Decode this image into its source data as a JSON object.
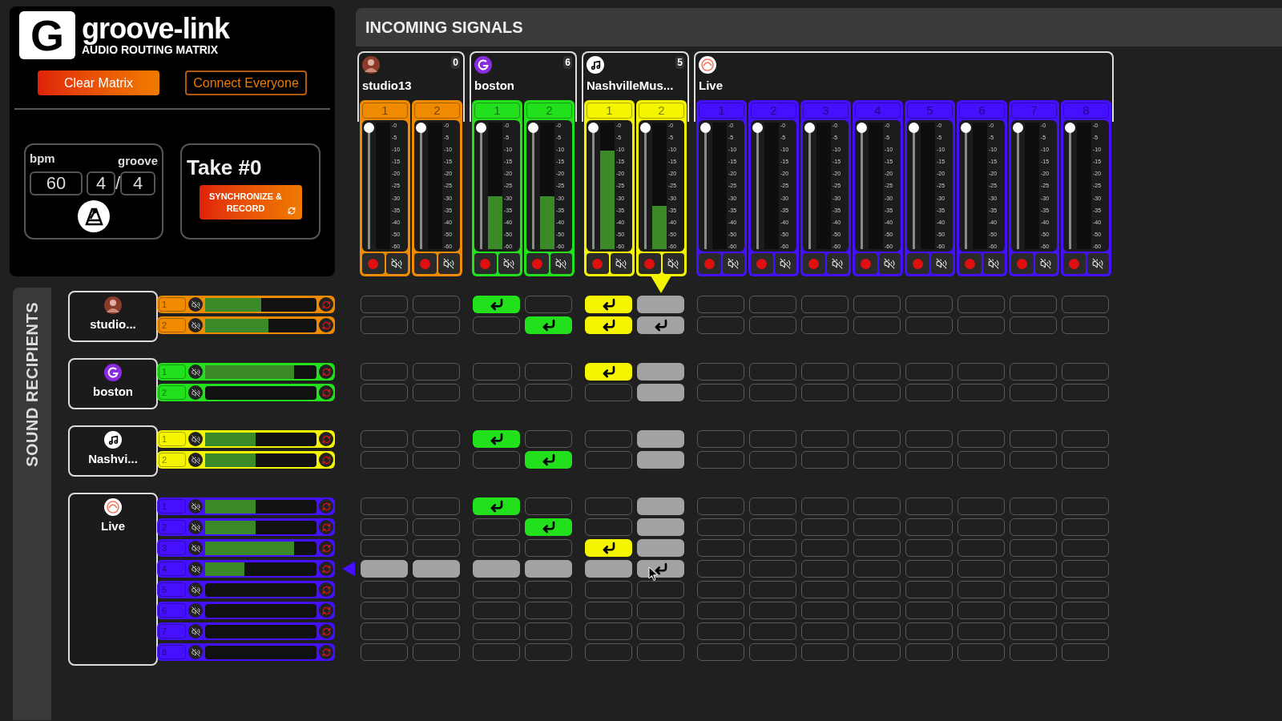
{
  "logo": {
    "mark": "G",
    "title": "groove-link",
    "subtitle": "AUDIO ROUTING MATRIX"
  },
  "actions": [
    {
      "label": "Clear Matrix",
      "kind": "filled"
    },
    {
      "label": "Connect Everyone",
      "kind": "outline"
    }
  ],
  "tempo": {
    "bpm_label": "bpm",
    "groove_label": "groove",
    "bpm": "60",
    "beats": "4",
    "separator": "/",
    "unit": "4"
  },
  "take": {
    "title": "Take #0",
    "button": "SYNCHRONIZE & RECORD"
  },
  "incoming": {
    "title": "INCOMING SIGNALS",
    "senders": [
      {
        "name": "studio13",
        "count": "0",
        "avatar": {
          "kind": "photo"
        },
        "color": "#f08a00",
        "channels": [
          {
            "label": "1",
            "hovered": false,
            "fader": {
              "level": 1
            },
            "meter": {
              "level": 0
            },
            "scale": [
              "-0",
              "-5",
              "-10",
              "-15",
              "-20",
              "-25",
              "-30",
              "-35",
              "-40",
              "-50",
              "-60"
            ]
          },
          {
            "label": "2",
            "hovered": false,
            "fader": {
              "level": 1
            },
            "meter": {
              "level": 0
            },
            "scale": [
              "-0",
              "-5",
              "-10",
              "-15",
              "-20",
              "-25",
              "-30",
              "-35",
              "-40",
              "-50",
              "-60"
            ]
          }
        ]
      },
      {
        "name": "boston",
        "count": "6",
        "avatar": {
          "kind": "logo"
        },
        "color": "#22e01c",
        "channels": [
          {
            "label": "1",
            "hovered": false,
            "fader": {
              "level": 1
            },
            "meter": {
              "level": 0.42
            },
            "scale": [
              "-0",
              "-5",
              "-10",
              "-15",
              "-20",
              "-25",
              "-30",
              "-35",
              "-40",
              "-50",
              "-60"
            ]
          },
          {
            "label": "2",
            "hovered": false,
            "fader": {
              "level": 1
            },
            "meter": {
              "level": 0.42
            },
            "scale": [
              "-0",
              "-5",
              "-10",
              "-15",
              "-20",
              "-25",
              "-30",
              "-35",
              "-40",
              "-50",
              "-60"
            ]
          }
        ]
      },
      {
        "name": "NashvilleMus...",
        "count": "5",
        "avatar": {
          "kind": "music"
        },
        "color": "#f5f500",
        "channels": [
          {
            "label": "1",
            "hovered": false,
            "fader": {
              "level": 1
            },
            "meter": {
              "level": 0.78
            },
            "scale": [
              "-0",
              "-5",
              "-10",
              "-15",
              "-20",
              "-25",
              "-30",
              "-35",
              "-40",
              "-50",
              "-60"
            ]
          },
          {
            "label": "2",
            "hovered": true,
            "fader": {
              "level": 1
            },
            "meter": {
              "level": 0.34
            },
            "scale": [
              "-0",
              "-5",
              "-10",
              "-15",
              "-20",
              "-25",
              "-30",
              "-35",
              "-40",
              "-50",
              "-60"
            ]
          }
        ]
      },
      {
        "name": "Live",
        "avatar": {
          "kind": "character"
        },
        "color": "#4510ff",
        "channels": [
          {
            "label": "1",
            "hovered": false,
            "fader": {
              "level": 1
            },
            "meter": {
              "level": 0
            },
            "scale": [
              "-0",
              "-5",
              "-10",
              "-15",
              "-20",
              "-25",
              "-30",
              "-35",
              "-40",
              "-50",
              "-60"
            ]
          },
          {
            "label": "2",
            "hovered": false,
            "fader": {
              "level": 1
            },
            "meter": {
              "level": 0
            },
            "scale": [
              "-0",
              "-5",
              "-10",
              "-15",
              "-20",
              "-25",
              "-30",
              "-35",
              "-40",
              "-50",
              "-60"
            ]
          },
          {
            "label": "3",
            "hovered": false,
            "fader": {
              "level": 1
            },
            "meter": {
              "level": 0
            },
            "scale": [
              "-0",
              "-5",
              "-10",
              "-15",
              "-20",
              "-25",
              "-30",
              "-35",
              "-40",
              "-50",
              "-60"
            ]
          },
          {
            "label": "4",
            "hovered": false,
            "fader": {
              "level": 1
            },
            "meter": {
              "level": 0
            },
            "scale": [
              "-0",
              "-5",
              "-10",
              "-15",
              "-20",
              "-25",
              "-30",
              "-35",
              "-40",
              "-50",
              "-60"
            ]
          },
          {
            "label": "5",
            "hovered": false,
            "fader": {
              "level": 1
            },
            "meter": {
              "level": 0
            },
            "scale": [
              "-0",
              "-5",
              "-10",
              "-15",
              "-20",
              "-25",
              "-30",
              "-35",
              "-40",
              "-50",
              "-60"
            ]
          },
          {
            "label": "6",
            "hovered": false,
            "fader": {
              "level": 1
            },
            "meter": {
              "level": 0
            },
            "scale": [
              "-0",
              "-5",
              "-10",
              "-15",
              "-20",
              "-25",
              "-30",
              "-35",
              "-40",
              "-50",
              "-60"
            ]
          },
          {
            "label": "7",
            "hovered": false,
            "fader": {
              "level": 1
            },
            "meter": {
              "level": 0
            },
            "scale": [
              "-0",
              "-5",
              "-10",
              "-15",
              "-20",
              "-25",
              "-30",
              "-35",
              "-40",
              "-50",
              "-60"
            ]
          },
          {
            "label": "8",
            "hovered": false,
            "fader": {
              "level": 1
            },
            "meter": {
              "level": 0
            },
            "scale": [
              "-0",
              "-5",
              "-10",
              "-15",
              "-20",
              "-25",
              "-30",
              "-35",
              "-40",
              "-50",
              "-60"
            ]
          }
        ]
      }
    ]
  },
  "recipients": {
    "title": "SOUND RECIPIENTS",
    "groups": [
      {
        "name": "studio...",
        "avatar": {
          "kind": "photo"
        },
        "color": "#f08a00",
        "channels": [
          {
            "label": "1",
            "hovered": false,
            "meter": {
              "level": 0.5
            },
            "routes": [
              false,
              false,
              true,
              false,
              true,
              false,
              false,
              false,
              false,
              false,
              false,
              false,
              false,
              false
            ]
          },
          {
            "label": "2",
            "hovered": false,
            "meter": {
              "level": 0.57
            },
            "routes": [
              false,
              false,
              false,
              true,
              true,
              true,
              false,
              false,
              false,
              false,
              false,
              false,
              false,
              false
            ]
          }
        ]
      },
      {
        "name": "boston",
        "avatar": {
          "kind": "logo"
        },
        "color": "#22e01c",
        "channels": [
          {
            "label": "1",
            "hovered": false,
            "meter": {
              "level": 0.8
            },
            "routes": [
              false,
              false,
              false,
              false,
              true,
              false,
              false,
              false,
              false,
              false,
              false,
              false,
              false,
              false
            ]
          },
          {
            "label": "2",
            "hovered": false,
            "meter": {
              "level": 0
            },
            "routes": [
              false,
              false,
              false,
              false,
              false,
              false,
              false,
              false,
              false,
              false,
              false,
              false,
              false,
              false
            ]
          }
        ]
      },
      {
        "name": "Nashvi...",
        "avatar": {
          "kind": "music"
        },
        "color": "#f5f500",
        "channels": [
          {
            "label": "1",
            "hovered": false,
            "meter": {
              "level": 0.45
            },
            "routes": [
              false,
              false,
              true,
              false,
              false,
              false,
              false,
              false,
              false,
              false,
              false,
              false,
              false,
              false
            ]
          },
          {
            "label": "2",
            "hovered": false,
            "meter": {
              "level": 0.45
            },
            "routes": [
              false,
              false,
              false,
              true,
              false,
              false,
              false,
              false,
              false,
              false,
              false,
              false,
              false,
              false
            ]
          }
        ]
      },
      {
        "name": "Live",
        "avatar": {
          "kind": "character"
        },
        "color": "#4510ff",
        "channels": [
          {
            "label": "1",
            "hovered": false,
            "meter": {
              "level": 0.45
            },
            "routes": [
              false,
              false,
              true,
              false,
              false,
              false,
              false,
              false,
              false,
              false,
              false,
              false,
              false,
              false
            ]
          },
          {
            "label": "2",
            "hovered": false,
            "meter": {
              "level": 0.45
            },
            "routes": [
              false,
              false,
              false,
              true,
              false,
              false,
              false,
              false,
              false,
              false,
              false,
              false,
              false,
              false
            ]
          },
          {
            "label": "3",
            "hovered": false,
            "meter": {
              "level": 0.8
            },
            "routes": [
              false,
              false,
              false,
              false,
              true,
              false,
              false,
              false,
              false,
              false,
              false,
              false,
              false,
              false
            ]
          },
          {
            "label": "4",
            "hovered": true,
            "meter": {
              "level": 0.35
            },
            "routes": [
              false,
              false,
              false,
              false,
              false,
              true,
              false,
              false,
              false,
              false,
              false,
              false,
              false,
              false
            ]
          },
          {
            "label": "5",
            "hovered": false,
            "meter": {
              "level": 0
            },
            "routes": [
              false,
              false,
              false,
              false,
              false,
              false,
              false,
              false,
              false,
              false,
              false,
              false,
              false,
              false
            ]
          },
          {
            "label": "6",
            "hovered": false,
            "meter": {
              "level": 0
            },
            "routes": [
              false,
              false,
              false,
              false,
              false,
              false,
              false,
              false,
              false,
              false,
              false,
              false,
              false,
              false
            ]
          },
          {
            "label": "7",
            "hovered": false,
            "meter": {
              "level": 0
            },
            "routes": [
              false,
              false,
              false,
              false,
              false,
              false,
              false,
              false,
              false,
              false,
              false,
              false,
              false,
              false
            ]
          },
          {
            "label": "8",
            "hovered": false,
            "meter": {
              "level": 0
            },
            "routes": [
              false,
              false,
              false,
              false,
              false,
              false,
              false,
              false,
              false,
              false,
              false,
              false,
              false,
              false
            ]
          }
        ]
      }
    ]
  }
}
